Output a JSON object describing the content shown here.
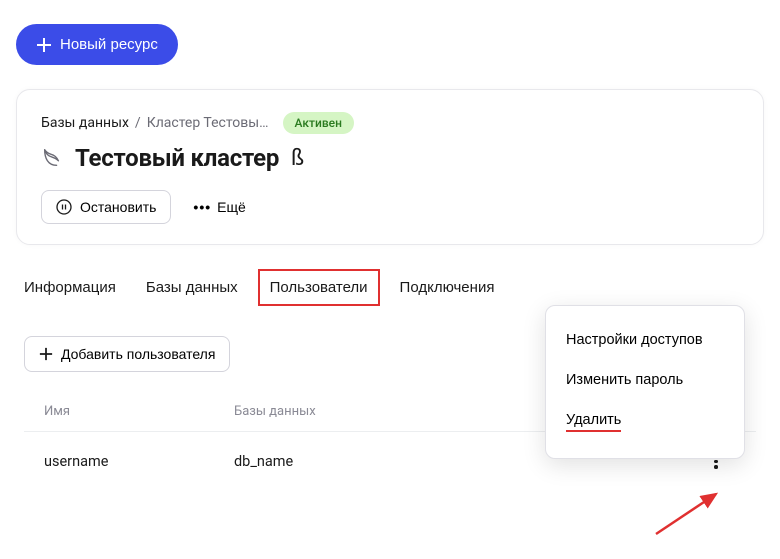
{
  "new_resource_label": "Новый ресурс",
  "breadcrumb": {
    "root": "Базы данных",
    "sep": "/",
    "current": "Кластер Тестовы…"
  },
  "status_badge": "Активен",
  "page_title": "Тестовый кластер",
  "beta_label": "ß",
  "stop_label": "Остановить",
  "more_label": "Ещё",
  "tabs": {
    "info": "Информация",
    "db": "Базы данных",
    "users": "Пользователи",
    "conn": "Подключения"
  },
  "add_user_label": "Добавить пользователя",
  "table": {
    "headers": {
      "name": "Имя",
      "db": "Базы данных"
    },
    "rows": [
      {
        "username": "username",
        "db": "db_name"
      }
    ]
  },
  "popover": {
    "access": "Настройки доступов",
    "password": "Изменить пароль",
    "delete": "Удалить"
  }
}
